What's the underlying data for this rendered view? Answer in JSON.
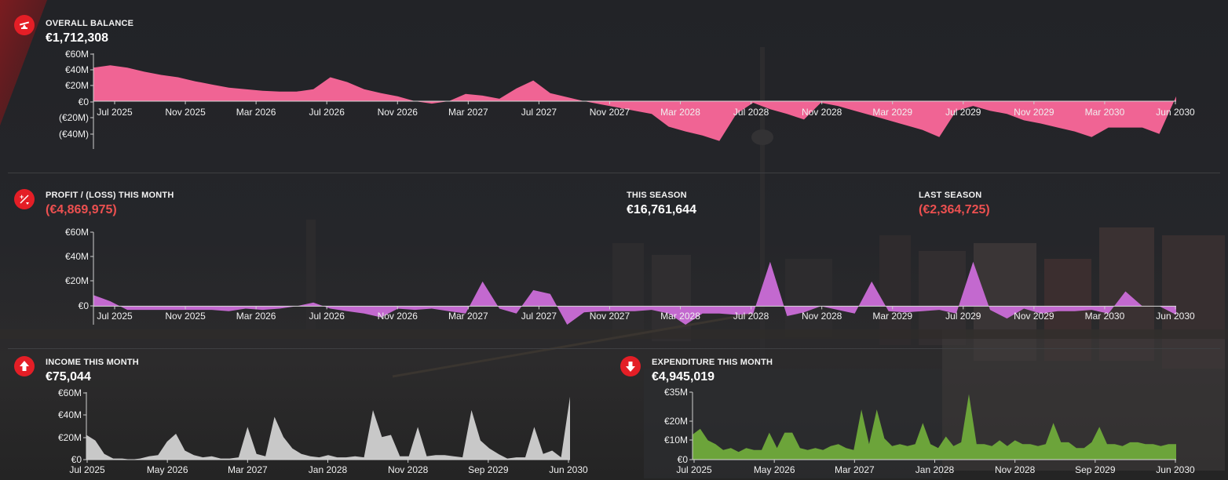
{
  "colors": {
    "accent": "#e41e26",
    "balance_fill": "#f06494",
    "profit_fill": "#c369cf",
    "income_fill": "#c8c8c8",
    "expenditure_fill": "#6ca43a",
    "negative_text": "#ec5050"
  },
  "overall_balance": {
    "icon": "scale-balance-icon",
    "title": "OVERALL BALANCE",
    "value": "€1,712,308",
    "chart_data": {
      "type": "area",
      "yticks": [
        "€60M",
        "€40M",
        "€20M",
        "€0",
        "(€20M)",
        "(€40M)"
      ],
      "ylim": [
        -60,
        60
      ],
      "xticks": [
        "Jul 2025",
        "Nov 2025",
        "Mar 2026",
        "Jul 2026",
        "Nov 2026",
        "Mar 2027",
        "Jul 2027",
        "Nov 2027",
        "Mar 2028",
        "Jul 2028",
        "Nov 2028",
        "Mar 2029",
        "Jul 2029",
        "Nov 2029",
        "Mar 2030",
        "Jun 2030"
      ],
      "values": [
        42,
        45,
        42,
        37,
        33,
        30,
        25,
        21,
        17,
        15,
        13,
        12,
        12,
        15,
        30,
        24,
        15,
        10,
        6,
        0,
        -3,
        0,
        9,
        7,
        3,
        16,
        26,
        10,
        5,
        0,
        -4,
        -8,
        -12,
        -16,
        -32,
        -38,
        -43,
        -50,
        -16,
        -2,
        -10,
        -16,
        -23,
        -2,
        -6,
        -12,
        -18,
        -24,
        -30,
        -36,
        -45,
        -12,
        -6,
        -12,
        -16,
        -24,
        -28,
        -33,
        -38,
        -45,
        -33,
        -33,
        -33,
        -41,
        6
      ]
    }
  },
  "profit_loss": {
    "icon": "profit-loss-icon",
    "title": "PROFIT / (LOSS) THIS MONTH",
    "value": "(€4,869,975)",
    "this_season_label": "THIS SEASON",
    "this_season_value": "€16,761,644",
    "last_season_label": "LAST SEASON",
    "last_season_value": "(€2,364,725)",
    "chart_data": {
      "type": "area",
      "yticks": [
        "€60M",
        "€40M",
        "€20M",
        "€0"
      ],
      "ylim": [
        -15,
        60
      ],
      "xticks": [
        "Jul 2025",
        "Nov 2025",
        "Mar 2026",
        "Jul 2026",
        "Nov 2026",
        "Mar 2027",
        "Jul 2027",
        "Nov 2027",
        "Mar 2028",
        "Jul 2028",
        "Nov 2028",
        "Mar 2029",
        "Jul 2029",
        "Nov 2029",
        "Mar 2030",
        "Jun 2030"
      ],
      "values": [
        9,
        4,
        -3,
        -3,
        -3,
        -3,
        -3,
        -3,
        -4,
        -2,
        -3,
        -2,
        0,
        3,
        -2,
        -4,
        -6,
        -9,
        -2,
        -3,
        -2,
        -4,
        -6,
        20,
        -2,
        -6,
        13,
        10,
        -15,
        -5,
        -4,
        -4,
        -4,
        -3,
        -6,
        -15,
        -6,
        -6,
        -7,
        -6,
        36,
        -8,
        -5,
        0,
        -3,
        -6,
        20,
        -4,
        -5,
        -4,
        -3,
        -6,
        36,
        -3,
        -10,
        -2,
        -6,
        -4,
        -4,
        -3,
        -6,
        12,
        0,
        0,
        -7
      ]
    }
  },
  "income": {
    "icon": "arrow-up-icon",
    "title": "INCOME THIS MONTH",
    "value": "€75,044",
    "chart_data": {
      "type": "area",
      "yticks": [
        "€60M",
        "€40M",
        "€20M",
        "€0"
      ],
      "ylim": [
        0,
        60
      ],
      "xticks": [
        "Jul 2025",
        "May 2026",
        "Mar 2027",
        "Jan 2028",
        "Nov 2028",
        "Sep 2029",
        "Jun 2030"
      ],
      "values": [
        22,
        17,
        5,
        1,
        1,
        0,
        1,
        3,
        4,
        16,
        23,
        8,
        4,
        2,
        3,
        1,
        1,
        2,
        29,
        5,
        3,
        38,
        20,
        10,
        5,
        3,
        2,
        4,
        2,
        2,
        3,
        2,
        44,
        20,
        22,
        3,
        3,
        29,
        3,
        4,
        4,
        3,
        2,
        44,
        17,
        10,
        5,
        1,
        2,
        2,
        29,
        5,
        8,
        2,
        56
      ]
    }
  },
  "expenditure": {
    "icon": "arrow-down-icon",
    "title": "EXPENDITURE THIS MONTH",
    "value": "€4,945,019",
    "chart_data": {
      "type": "area",
      "yticks": [
        "€35M",
        "€20M",
        "€10M",
        "€0"
      ],
      "ylim": [
        0,
        35
      ],
      "xticks": [
        "Jul 2025",
        "May 2026",
        "Mar 2027",
        "Jan 2028",
        "Nov 2028",
        "Sep 2029",
        "Jun 2030"
      ],
      "values": [
        13,
        16,
        10,
        8,
        5,
        6,
        4,
        6,
        5,
        5,
        14,
        6,
        14,
        14,
        6,
        5,
        6,
        5,
        7,
        8,
        6,
        5,
        26,
        8,
        26,
        11,
        7,
        8,
        7,
        8,
        19,
        8,
        6,
        12,
        7,
        9,
        34,
        8,
        8,
        7,
        10,
        7,
        10,
        8,
        8,
        7,
        8,
        19,
        9,
        9,
        6,
        6,
        9,
        17,
        8,
        8,
        7,
        9,
        9,
        8,
        8,
        7,
        8,
        8
      ]
    }
  }
}
